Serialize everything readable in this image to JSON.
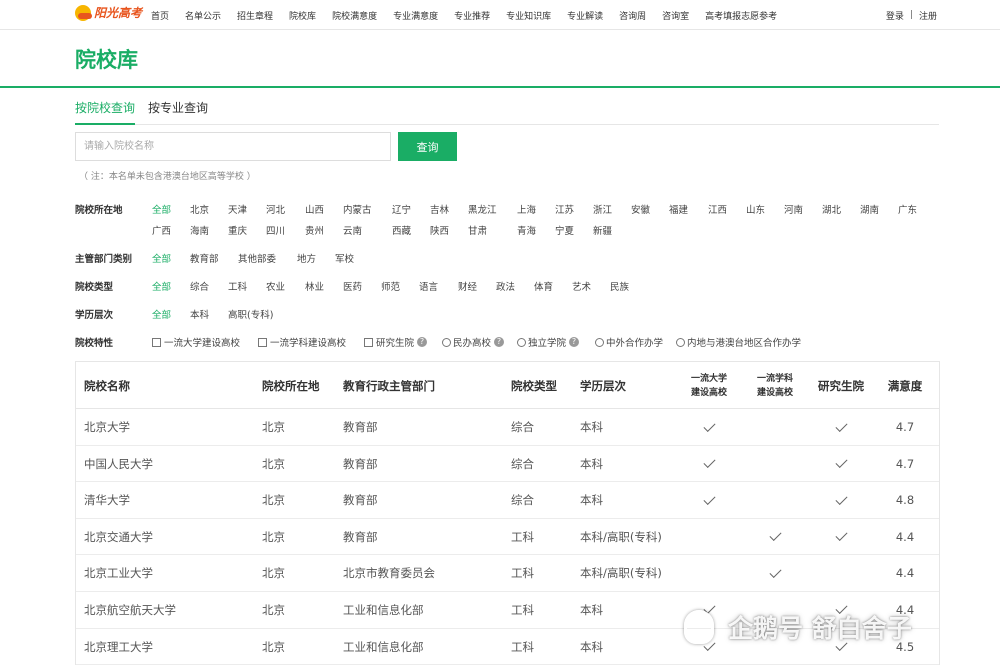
{
  "header": {
    "logo_text": "阳光高考",
    "nav": [
      "首页",
      "名单公示",
      "招生章程",
      "院校库",
      "院校满意度",
      "专业满意度",
      "专业推荐",
      "专业知识库",
      "专业解读",
      "咨询周",
      "咨询室",
      "高考填报志愿参考"
    ],
    "login": "登录",
    "separator": "|",
    "register": "注册"
  },
  "page_title": "院校库",
  "tabs": [
    "按院校查询",
    "按专业查询"
  ],
  "search": {
    "placeholder": "请输入院校名称",
    "button": "查询"
  },
  "note": "（ 注：本名单未包含港澳台地区高等学校 ）",
  "filters": {
    "location": {
      "label": "院校所在地",
      "options": [
        "全部",
        "北京",
        "天津",
        "河北",
        "山西",
        "内蒙古",
        "辽宁",
        "吉林",
        "黑龙江",
        "上海",
        "江苏",
        "浙江",
        "安徽",
        "福建",
        "江西",
        "山东",
        "河南",
        "湖北",
        "湖南",
        "广东",
        "广西",
        "海南",
        "重庆",
        "四川",
        "贵州",
        "云南",
        "西藏",
        "陕西",
        "甘肃",
        "青海",
        "宁夏",
        "新疆"
      ]
    },
    "dept": {
      "label": "主管部门类别",
      "options": [
        "全部",
        "教育部",
        "其他部委",
        "地方",
        "军校"
      ]
    },
    "type": {
      "label": "院校类型",
      "options": [
        "全部",
        "综合",
        "工科",
        "农业",
        "林业",
        "医药",
        "师范",
        "语言",
        "财经",
        "政法",
        "体育",
        "艺术",
        "民族"
      ]
    },
    "level": {
      "label": "学历层次",
      "options": [
        "全部",
        "本科",
        "高职(专科)"
      ]
    },
    "feature": {
      "label": "院校特性",
      "options": [
        "一流大学建设高校",
        "一流学科建设高校",
        "研究生院",
        "民办高校",
        "独立学院",
        "中外合作办学",
        "内地与港澳台地区合作办学"
      ]
    }
  },
  "table": {
    "headers": [
      "院校名称",
      "院校所在地",
      "教育行政主管部门",
      "院校类型",
      "学历层次",
      "一流大学\n建设高校",
      "一流学科\n建设高校",
      "研究生院",
      "满意度"
    ],
    "rows": [
      {
        "name": "北京大学",
        "loc": "北京",
        "dept": "教育部",
        "type": "综合",
        "level": "本科",
        "c1": true,
        "c2": false,
        "grad": true,
        "score": "4.7"
      },
      {
        "name": "中国人民大学",
        "loc": "北京",
        "dept": "教育部",
        "type": "综合",
        "level": "本科",
        "c1": true,
        "c2": false,
        "grad": true,
        "score": "4.7"
      },
      {
        "name": "清华大学",
        "loc": "北京",
        "dept": "教育部",
        "type": "综合",
        "level": "本科",
        "c1": true,
        "c2": false,
        "grad": true,
        "score": "4.8"
      },
      {
        "name": "北京交通大学",
        "loc": "北京",
        "dept": "教育部",
        "type": "工科",
        "level": "本科/高职(专科)",
        "c1": false,
        "c2": true,
        "grad": true,
        "score": "4.4"
      },
      {
        "name": "北京工业大学",
        "loc": "北京",
        "dept": "北京市教育委员会",
        "type": "工科",
        "level": "本科/高职(专科)",
        "c1": false,
        "c2": true,
        "grad": false,
        "score": "4.4"
      },
      {
        "name": "北京航空航天大学",
        "loc": "北京",
        "dept": "工业和信息化部",
        "type": "工科",
        "level": "本科",
        "c1": true,
        "c2": false,
        "grad": true,
        "score": "4.4"
      },
      {
        "name": "北京理工大学",
        "loc": "北京",
        "dept": "工业和信息化部",
        "type": "工科",
        "level": "本科",
        "c1": true,
        "c2": false,
        "grad": true,
        "score": "4.5"
      }
    ]
  },
  "watermark": "企鹅号 舒白舍子"
}
